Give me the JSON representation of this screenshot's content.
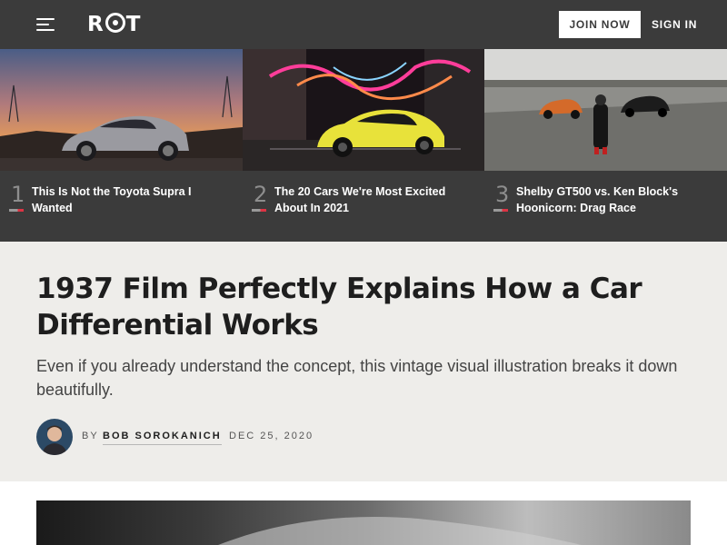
{
  "header": {
    "logo_text": "ROT",
    "join_label": "JOIN NOW",
    "signin_label": "SIGN IN",
    "menu_icon": "hamburger-menu-icon"
  },
  "trending": [
    {
      "rank": "1",
      "title": "This Is Not the Toyota Supra I Wanted"
    },
    {
      "rank": "2",
      "title": "The 20 Cars We're Most Excited About In 2021"
    },
    {
      "rank": "3",
      "title": "Shelby GT500 vs. Ken Block's Hoonicorn: Drag Race"
    }
  ],
  "article": {
    "headline": "1937 Film Perfectly Explains How a Car Differential Works",
    "dek": "Even if you already understand the concept, this vintage visual illustration breaks it down beautifully.",
    "by_prefix": "BY",
    "author": "BOB SOROKANICH",
    "date": "DEC 25, 2020"
  },
  "colors": {
    "header_bg": "#3b3b3b",
    "article_bg": "#eeedea",
    "accent_red": "#dd3344"
  }
}
